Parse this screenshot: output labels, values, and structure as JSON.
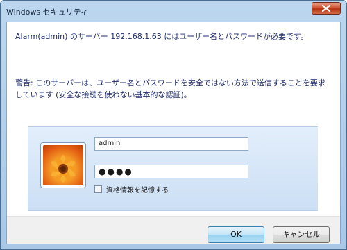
{
  "window": {
    "title": "Windows セキュリティ"
  },
  "dialog": {
    "message_line1": "Alarm(admin) のサーバー 192.168.1.63 にはユーザー名とパスワードが必要です。",
    "message_line2": "警告: このサーバーは、ユーザー名とパスワードを安全ではない方法で送信することを要求しています (安全な接続を使わない基本的な認証)。"
  },
  "credentials": {
    "username": "admin",
    "password_masked": "●●●●",
    "remember_label": "資格情報を記憶する",
    "remember_checked": false,
    "avatar_icon": "user-tile-flower-icon"
  },
  "buttons": {
    "ok_label": "OK",
    "cancel_label": "キャンセル",
    "close_icon": "close-icon"
  },
  "colors": {
    "title_bar": "#a9c8e8",
    "message_text": "#1c2a6b",
    "credential_band": "#d6e6f7",
    "close_button": "#c8421f",
    "ok_button": "#b6e0f4"
  }
}
